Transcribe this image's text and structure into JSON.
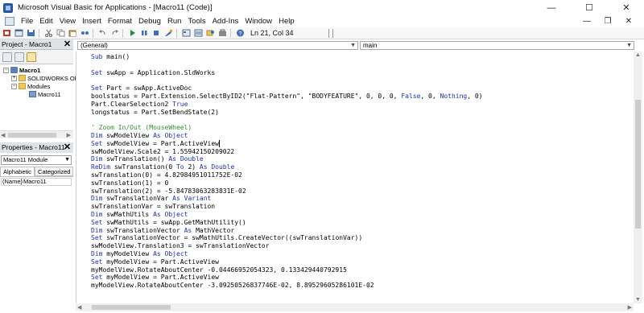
{
  "window": {
    "title": "Microsoft Visual Basic for Applications - [Macro11 (Code)]",
    "minimize": "—",
    "maximize": "☐",
    "close": "✕"
  },
  "menu": {
    "items": [
      "File",
      "Edit",
      "View",
      "Insert",
      "Format",
      "Debug",
      "Run",
      "Tools",
      "Add-Ins",
      "Window",
      "Help"
    ],
    "doc_minimize": "—",
    "doc_restore": "❐",
    "doc_close": "✕"
  },
  "toolbar": {
    "position": "Ln 21, Col 34"
  },
  "project": {
    "title": "Project - Macro1",
    "tree": [
      {
        "label": "Macro1"
      },
      {
        "label": "SOLIDWORKS Obj"
      },
      {
        "label": "Modules"
      },
      {
        "label": "Macro11"
      }
    ]
  },
  "properties": {
    "title": "Properties - Macro11",
    "object": "Macro11 Module",
    "tabs": [
      "Alphabetic",
      "Categorized"
    ],
    "rows": [
      {
        "key": "(Name)",
        "value": "Macro11"
      }
    ]
  },
  "code": {
    "object_combo": "(General)",
    "proc_combo": "main",
    "lines": [
      [
        "Sub main()"
      ],
      [
        ""
      ],
      [
        "Set swApp = Application.SldWorks"
      ],
      [
        ""
      ],
      [
        "Set Part = swApp.ActiveDoc"
      ],
      [
        "boolstatus = Part.Extension.SelectByID2(\"Flat-Pattern\", \"BODYFEATURE\", 0, 0, 0, False, 0, Nothing, 0)"
      ],
      [
        "Part.ClearSelection2 True"
      ],
      [
        "longstatus = Part.SetBendState(2)"
      ],
      [
        ""
      ],
      [
        "' Zoom In/Out (MouseWheel)"
      ],
      [
        "Dim swModelView As Object"
      ],
      [
        "Set swModelView = Part.ActiveView"
      ],
      [
        "swModelView.Scale2 = 1.55942150209022"
      ],
      [
        "Dim swTranslation() As Double"
      ],
      [
        "ReDim swTranslation(0 To 2) As Double"
      ],
      [
        "swTranslation(0) = 4.82984951011752E-02"
      ],
      [
        "swTranslation(1) = 0"
      ],
      [
        "swTranslation(2) = -5.84783063283831E-02"
      ],
      [
        "Dim swTranslationVar As Variant"
      ],
      [
        "swTranslationVar = swTranslation"
      ],
      [
        "Dim swMathUtils As Object"
      ],
      [
        "Set swMathUtils = swApp.GetMathUtility()"
      ],
      [
        "Dim swTranslationVector As MathVector"
      ],
      [
        "Set swTranslationVector = swMathUtils.CreateVector((swTranslationVar))"
      ],
      [
        "swModelView.Translation3 = swTranslationVector"
      ],
      [
        "Dim myModelView As Object"
      ],
      [
        "Set myModelView = Part.ActiveView"
      ],
      [
        "myModelView.RotateAboutCenter -0.04466952054323, 0.133429440792915"
      ],
      [
        "Set myModelView = Part.ActiveView"
      ],
      [
        "myModelView.RotateAboutCenter -3.09250526837746E-02, 8.89529605286101E-02"
      ]
    ]
  },
  "colors": {
    "keyword": "#1f2fb0",
    "comment": "#2f8f2f",
    "text": "#000000"
  }
}
